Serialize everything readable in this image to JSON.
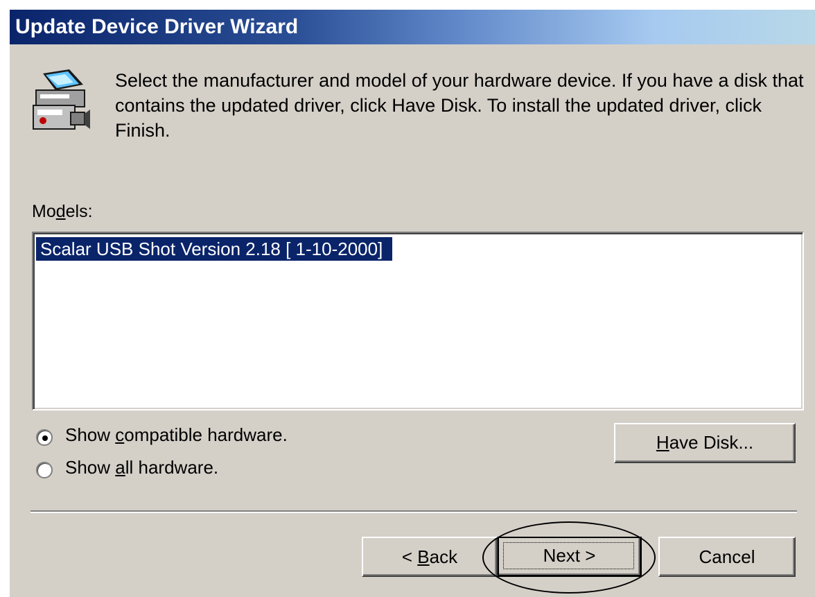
{
  "window": {
    "title": "Update Device Driver Wizard"
  },
  "header": {
    "icon": "scanner-camera-icon",
    "instructions": "Select the manufacturer and model of your hardware device. If you have a disk that contains the updated driver, click Have Disk. To install the updated driver, click Finish."
  },
  "models": {
    "label": "Models:",
    "items": [
      {
        "label": "Scalar USB Shot Version 2.18 [ 1-10-2000]",
        "selected": true
      }
    ]
  },
  "options": {
    "compatible": {
      "label": "Show compatible hardware.",
      "checked": true
    },
    "all": {
      "label": "Show all hardware.",
      "checked": false
    }
  },
  "buttons": {
    "have_disk": "Have Disk...",
    "back": "< Back",
    "next": "Next >",
    "cancel": "Cancel"
  },
  "colors": {
    "dialog_bg": "#d4d0c8",
    "title_start": "#0a246a",
    "title_end": "#a6caf0",
    "selection_bg": "#0a246a"
  }
}
